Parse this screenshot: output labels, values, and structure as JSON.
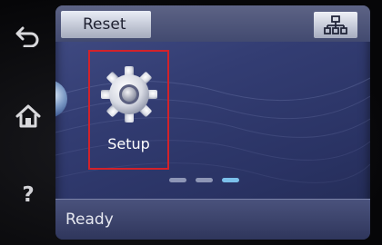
{
  "hardware": {
    "back_icon": "back-arrow-icon",
    "home_icon": "home-icon",
    "help_label": "?"
  },
  "topbar": {
    "reset_label": "Reset",
    "network_icon": "network-icon"
  },
  "main": {
    "setup_label": "Setup",
    "setup_icon": "gear-icon",
    "selected_outline_color": "#d3222a"
  },
  "pager": {
    "page_count": 3,
    "current_page": 3
  },
  "status": {
    "text": "Ready"
  }
}
